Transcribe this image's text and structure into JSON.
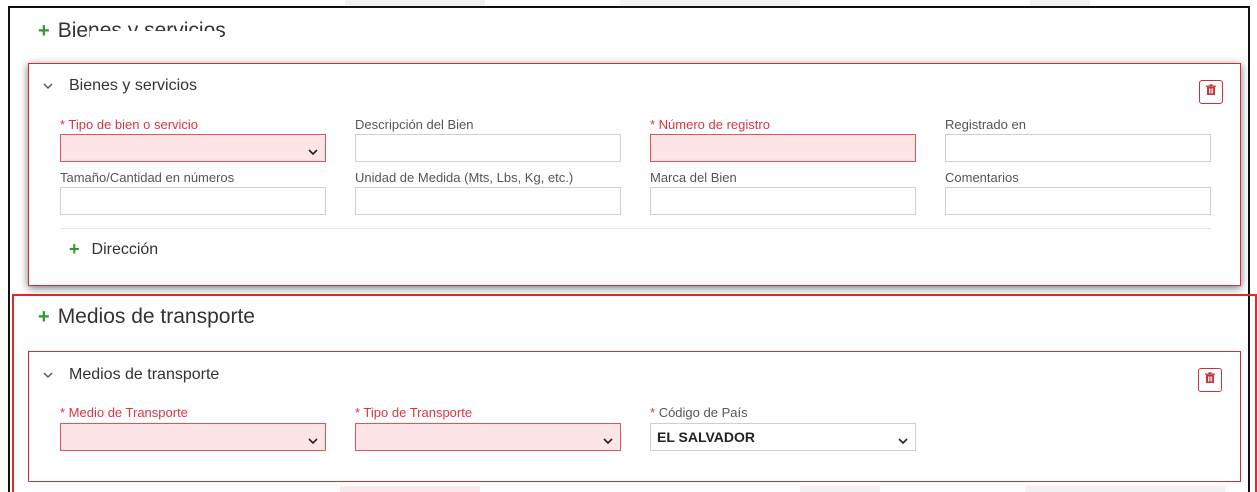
{
  "sections": {
    "goods_header": "Bienes y servicios",
    "transport_header": "Medios de transporte"
  },
  "goods_card": {
    "title": "Bienes y servicios",
    "fields": {
      "tipo_bien": {
        "label": "* Tipo de bien o servicio"
      },
      "descripcion": {
        "label": "Descripción del Bien"
      },
      "numero_registro": {
        "label": "* Número de registro"
      },
      "registrado_en": {
        "label": "Registrado en"
      },
      "tamano": {
        "label": "Tamaño/Cantidad en números"
      },
      "unidad_medida": {
        "label": "Unidad de Medida (Mts, Lbs, Kg, etc.)"
      },
      "marca": {
        "label": "Marca del Bien"
      },
      "comentarios": {
        "label": "Comentarios"
      }
    },
    "direccion_link": "Dirección"
  },
  "transport_card": {
    "title": "Medios de transporte",
    "fields": {
      "medio": {
        "label": "* Medio de Transporte"
      },
      "tipo": {
        "label": "* Tipo de Transporte"
      },
      "codigo_pais": {
        "star": "*",
        "label": "Código de País",
        "value": "EL SALVADOR"
      }
    }
  },
  "icons": {
    "plus": "plus-icon",
    "chevron": "chevron-down-icon",
    "trash": "trash-icon",
    "caret": "caret-down-icon"
  },
  "colors": {
    "required": "#d9363e",
    "error_bg": "#fde5e7",
    "add_green": "#2e9a2e",
    "card_border": "#c9323a",
    "highlight_frame": "#d92b2b"
  }
}
